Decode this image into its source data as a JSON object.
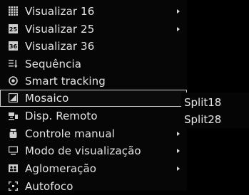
{
  "menu": {
    "items": [
      {
        "label": "Visualizar 16",
        "icon": "grid16-icon",
        "submenu": true
      },
      {
        "label": "Visualizar 25",
        "icon": "grid25-icon",
        "submenu": true
      },
      {
        "label": "Visualizar 36",
        "icon": "grid36-icon",
        "submenu": false
      },
      {
        "label": "Sequência",
        "icon": "sequence-icon",
        "submenu": false
      },
      {
        "label": "Smart tracking",
        "icon": "smart-tracking-icon",
        "submenu": false
      },
      {
        "label": "Mosaico",
        "icon": "mosaic-icon",
        "submenu": false,
        "selected": true
      },
      {
        "label": "Disp. Remoto",
        "icon": "remote-device-icon",
        "submenu": false
      },
      {
        "label": "Controle manual",
        "icon": "manual-control-icon",
        "submenu": true
      },
      {
        "label": "Modo de visualização",
        "icon": "view-mode-icon",
        "submenu": true
      },
      {
        "label": "Aglomeração",
        "icon": "crowd-icon",
        "submenu": true
      },
      {
        "label": "Autofoco",
        "icon": "autofocus-icon",
        "submenu": false
      }
    ]
  },
  "submenu": {
    "items": [
      {
        "label": "Split18"
      },
      {
        "label": "Split28"
      }
    ]
  },
  "colors": {
    "background": "#000000",
    "text": "#e4e4e4",
    "selection_border": "#cfcfcf"
  }
}
